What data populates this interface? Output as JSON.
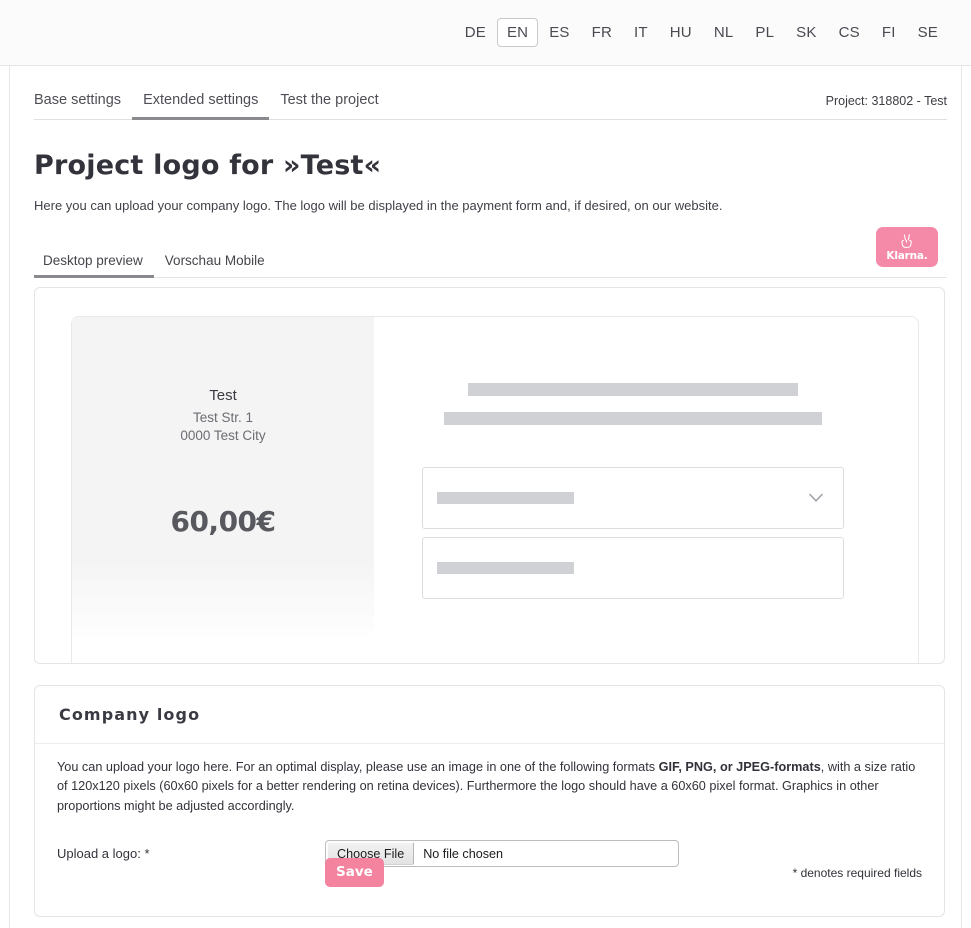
{
  "languages": {
    "items": [
      "DE",
      "EN",
      "ES",
      "FR",
      "IT",
      "HU",
      "NL",
      "PL",
      "SK",
      "CS",
      "FI",
      "SE"
    ],
    "active": "EN"
  },
  "tabs": {
    "items": [
      "Base settings",
      "Extended settings",
      "Test the project"
    ],
    "active": "Extended settings"
  },
  "project_tag": "Project: 318802 - Test",
  "page": {
    "heading": "Project logo for »Test«",
    "subheading": "Here you can upload your company logo. The logo will be displayed in the payment form and, if desired, on our website."
  },
  "brand_badge": {
    "name": "Klarna.",
    "icon": "peace-hand-icon",
    "color": "#f48aa8"
  },
  "preview_tabs": {
    "items": [
      "Desktop preview",
      "Vorschau Mobile"
    ],
    "active": "Desktop preview"
  },
  "preview": {
    "merchant_name": "Test",
    "address_line_1": "Test Str. 1",
    "address_line_2": "0000 Test City",
    "price": "60,00€",
    "select_icon": "chevron-down-icon"
  },
  "company_logo": {
    "title": "Company logo",
    "description_part_1": "You can upload your logo here. For an optimal display, please use an image in one of the following formats ",
    "description_bold": "GIF, PNG, or JPEG-formats",
    "description_part_2": ", with a size ratio of 120x120 pixels (60x60 pixels for a better rendering on retina devices). Furthermore the logo should have a 60x60 pixel format. Graphics in other proportions might be adjusted accordingly.",
    "upload_label": "Upload a logo: *",
    "file_button": "Choose File",
    "file_status": "No file chosen",
    "save_label": "Save",
    "required_note": "* denotes required fields"
  }
}
